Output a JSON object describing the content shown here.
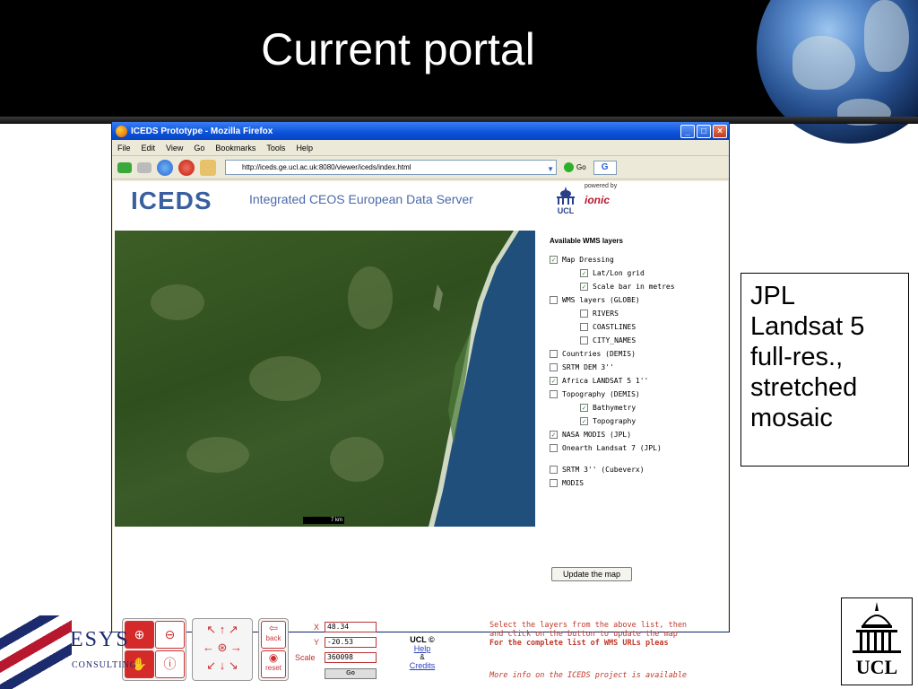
{
  "slide": {
    "title": "Current portal",
    "callout": [
      "JPL",
      "Landsat 5",
      "full-res.,",
      "stretched",
      "mosaic"
    ]
  },
  "browser": {
    "window_title": "ICEDS Prototype - Mozilla Firefox",
    "menu": [
      "File",
      "Edit",
      "View",
      "Go",
      "Bookmarks",
      "Tools",
      "Help"
    ],
    "url": "http://iceds.ge.ucl.ac.uk:8080/viewer/iceds/index.html",
    "go_label": "Go",
    "search_glyph": "G"
  },
  "page": {
    "logo": "ICEDS",
    "subtitle": "Integrated CEOS European Data Server",
    "ucl_small": "UCL",
    "powered_by": "powered by",
    "ionic": "ionic",
    "scale_bar_label": "7 km",
    "layers_heading": "Available WMS layers",
    "layers": [
      {
        "label": "Map Dressing",
        "checked": true,
        "indent": 0
      },
      {
        "label": "Lat/Lon grid",
        "checked": true,
        "indent": 1
      },
      {
        "label": "Scale bar in metres",
        "checked": true,
        "indent": 1
      },
      {
        "label": "WMS layers (GLOBE)",
        "checked": false,
        "indent": 0
      },
      {
        "label": "RIVERS",
        "checked": false,
        "indent": 1
      },
      {
        "label": "COASTLINES",
        "checked": false,
        "indent": 1
      },
      {
        "label": "CITY_NAMES",
        "checked": false,
        "indent": 1
      },
      {
        "label": "Countries (DEMIS)",
        "checked": false,
        "indent": 0
      },
      {
        "label": "SRTM DEM 3''",
        "checked": false,
        "indent": 0
      },
      {
        "label": "Africa LANDSAT 5 1''",
        "checked": true,
        "indent": 0
      },
      {
        "label": "Topography (DEMIS)",
        "checked": false,
        "indent": 0
      },
      {
        "label": "Bathymetry",
        "checked": true,
        "indent": 1
      },
      {
        "label": "Topography",
        "checked": true,
        "indent": 1
      },
      {
        "label": "NASA MODIS (JPL)",
        "checked": true,
        "indent": 0
      },
      {
        "label": "Onearth Landsat 7 (JPL)",
        "checked": false,
        "indent": 0
      },
      {
        "label": "SRTM 3'' (Cubeverx)",
        "checked": false,
        "indent": 0
      },
      {
        "label": "MODIS",
        "checked": false,
        "indent": 0
      }
    ],
    "update_button": "Update the map",
    "nav": {
      "back": "back",
      "reset": "reset"
    },
    "coords": {
      "x_label": "X",
      "x_value": "48.34",
      "y_label": "Y",
      "y_value": "-20.53",
      "scale_label": "Scale",
      "scale_value": "360098",
      "go": "Go"
    },
    "links": {
      "copyright": "UCL ©",
      "help": "Help",
      "amp": "&",
      "credits": "Credits"
    },
    "info": {
      "line1": "Select the layers from the above list, then",
      "line2": "and click on the button to update the map",
      "line3": "For the complete list of WMS URLs pleas",
      "line4": "More info on the ICEDS project is available"
    }
  },
  "logos": {
    "esys": "ESYS",
    "esys_sub": "CONSULTING",
    "ucl": "UCL"
  }
}
